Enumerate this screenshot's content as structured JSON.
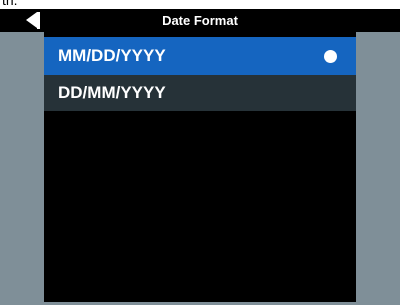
{
  "fragment_text": "th.",
  "header": {
    "title": "Date Format"
  },
  "options": [
    {
      "label": "MM/DD/YYYY",
      "selected": true
    },
    {
      "label": "DD/MM/YYYY",
      "selected": false
    }
  ],
  "colors": {
    "header_bg": "#000000",
    "side_panel": "#7f8f98",
    "selected_row": "#1565c0",
    "unselected_row": "#263238",
    "content_bg": "#000000",
    "text": "#ffffff"
  }
}
